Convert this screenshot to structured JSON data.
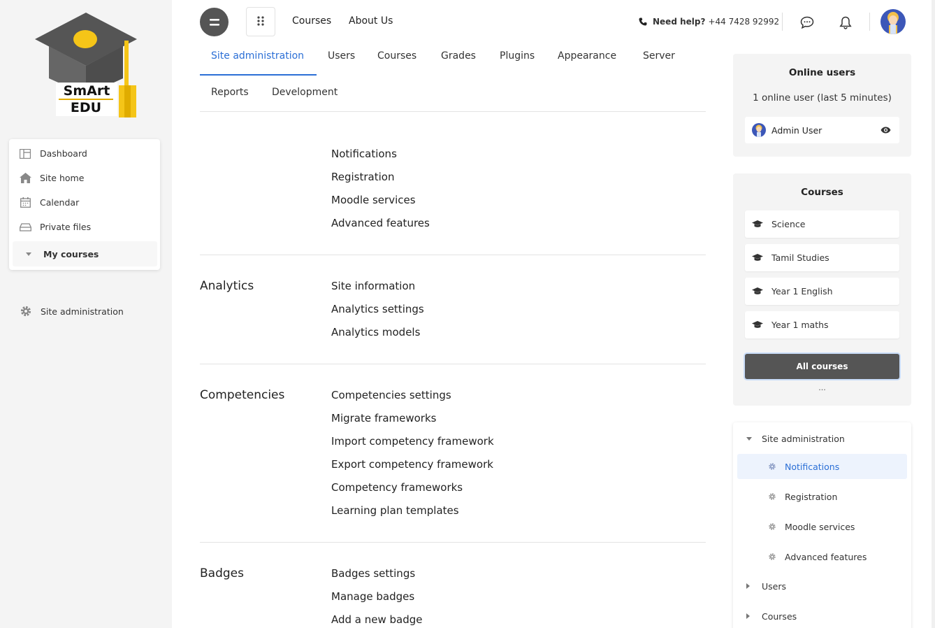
{
  "brand": {
    "line1": "SmArt",
    "line2": "EDU"
  },
  "sidebar": {
    "items": [
      {
        "label": "Dashboard",
        "icon": "dashboard-icon"
      },
      {
        "label": "Site home",
        "icon": "home-icon"
      },
      {
        "label": "Calendar",
        "icon": "calendar-icon"
      },
      {
        "label": "Private files",
        "icon": "drive-icon"
      }
    ],
    "my_courses": "My courses",
    "site_admin": "Site administration"
  },
  "topbar": {
    "links": [
      "Courses",
      "About Us"
    ],
    "help_label": "Need help?",
    "help_phone": "+44 7428 92992"
  },
  "tabs": [
    "Site administration",
    "Users",
    "Courses",
    "Grades",
    "Plugins",
    "Appearance",
    "Server",
    "Reports",
    "Development"
  ],
  "sections": [
    {
      "title": "",
      "links": [
        "Notifications",
        "Registration",
        "Moodle services",
        "Advanced features"
      ]
    },
    {
      "title": "Analytics",
      "links": [
        "Site information",
        "Analytics settings",
        "Analytics models"
      ]
    },
    {
      "title": "Competencies",
      "links": [
        "Competencies settings",
        "Migrate frameworks",
        "Import competency framework",
        "Export competency framework",
        "Competency frameworks",
        "Learning plan templates"
      ]
    },
    {
      "title": "Badges",
      "links": [
        "Badges settings",
        "Manage badges",
        "Add a new badge"
      ]
    }
  ],
  "online_users": {
    "title": "Online users",
    "summary": "1 online user (last 5 minutes)",
    "user": "Admin User"
  },
  "courses_block": {
    "title": "Courses",
    "items": [
      "Science",
      "Tamil Studies",
      "Year 1 English",
      "Year 1 maths"
    ],
    "all_label": "All courses",
    "more": "..."
  },
  "admin_tree": {
    "root": "Site administration",
    "children": [
      "Notifications",
      "Registration",
      "Moodle services",
      "Advanced features"
    ],
    "siblings": [
      "Users",
      "Courses"
    ]
  },
  "colors": {
    "accent": "#2b6fd6",
    "dark_button": "#555555",
    "logo_yellow": "#f5c518"
  }
}
